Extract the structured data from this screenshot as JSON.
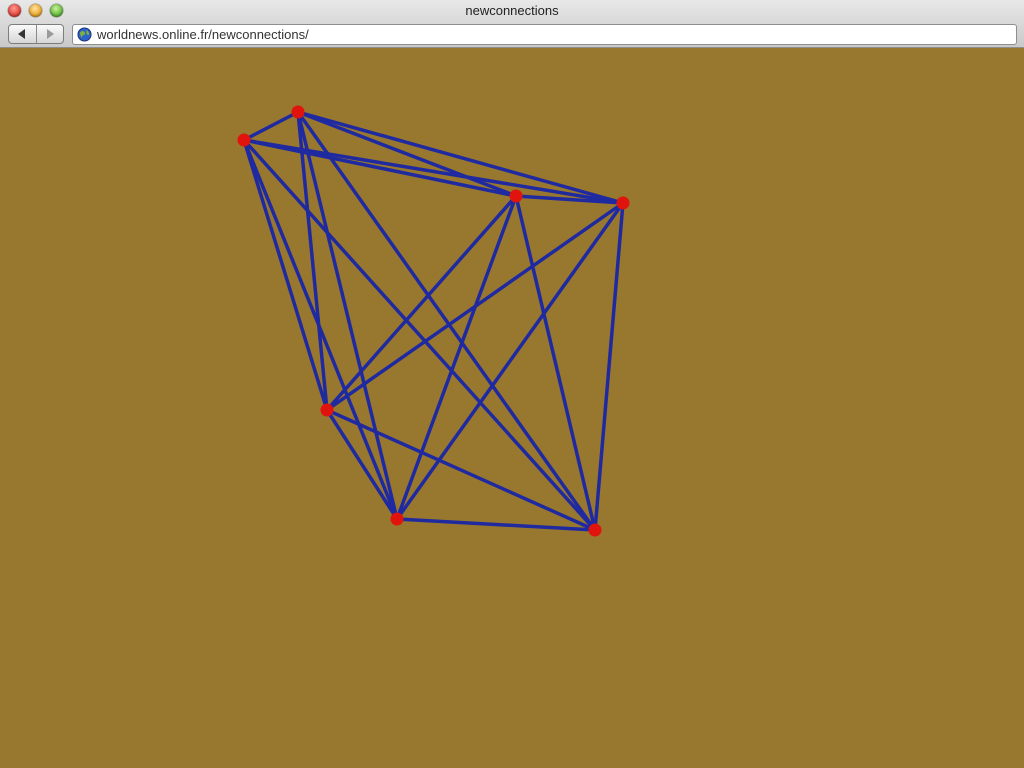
{
  "window": {
    "title": "newconnections",
    "traffic_lights": [
      "close",
      "minimize",
      "zoom"
    ]
  },
  "toolbar": {
    "back_icon": "back-arrow-icon",
    "forward_icon": "forward-arrow-icon",
    "address_icon": "globe-icon",
    "url": "worldnews.online.fr/newconnections/"
  },
  "content": {
    "background_color": "#98772f",
    "edge_color": "#1f2aa0",
    "node_color": "#e0140c",
    "node_count": 7,
    "edge_count": 21
  }
}
